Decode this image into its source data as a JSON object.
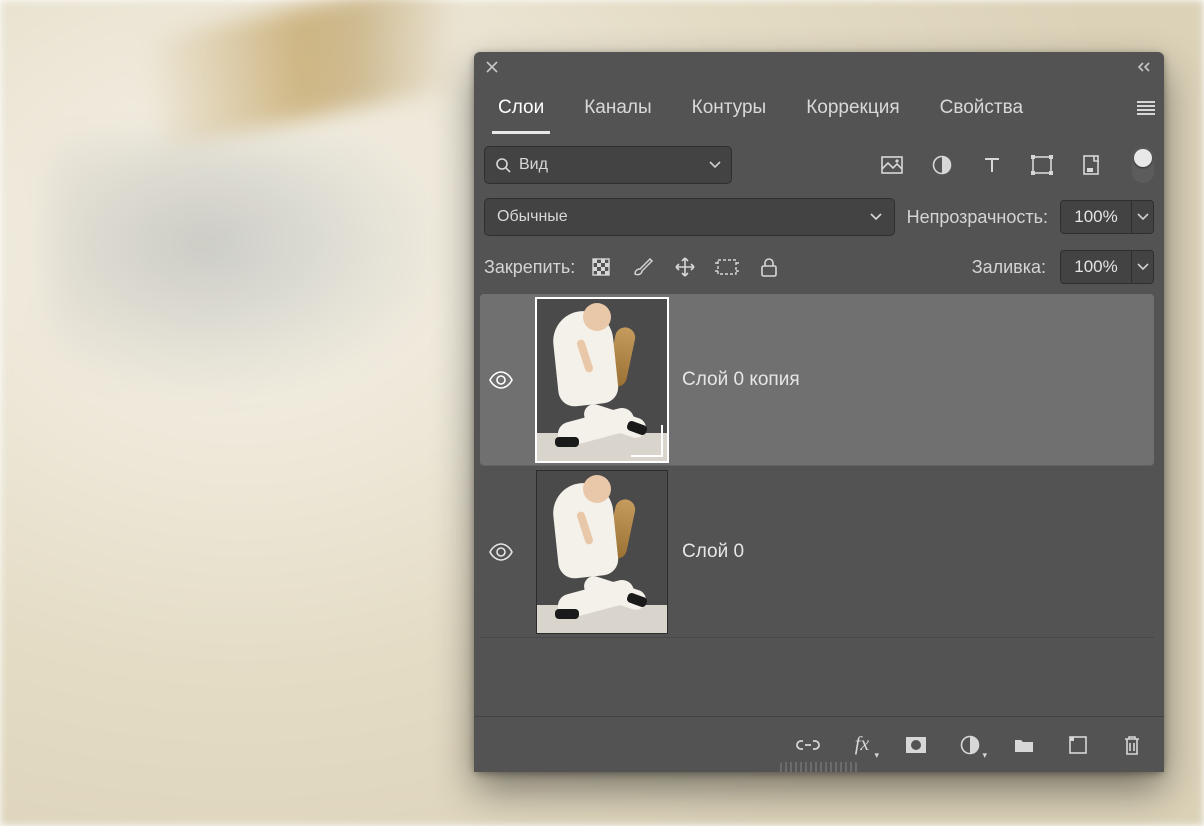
{
  "tabs": {
    "layers": "Слои",
    "channels": "Каналы",
    "paths": "Контуры",
    "adjustments": "Коррекция",
    "properties": "Свойства"
  },
  "filter": {
    "label": "Вид",
    "icon": "search-icon"
  },
  "quick_icons": [
    "image-filter-icon",
    "circle-half-icon",
    "type-icon",
    "shape-icon",
    "smartobject-icon"
  ],
  "blend": {
    "mode": "Обычные"
  },
  "opacity": {
    "label": "Непрозрачность:",
    "value": "100%"
  },
  "fill": {
    "label": "Заливка:",
    "value": "100%"
  },
  "lock": {
    "label": "Закрепить:",
    "icons": [
      "lock-pixels-icon",
      "lock-brush-icon",
      "lock-position-icon",
      "lock-artboard-icon",
      "lock-all-icon"
    ]
  },
  "layers": [
    {
      "name": "Слой 0 копия",
      "visible": true,
      "selected": true
    },
    {
      "name": "Слой 0",
      "visible": true,
      "selected": false
    }
  ],
  "footer_icons": [
    "link-icon",
    "fx-icon",
    "mask-icon",
    "adjustment-icon",
    "group-icon",
    "new-layer-icon",
    "trash-icon"
  ]
}
